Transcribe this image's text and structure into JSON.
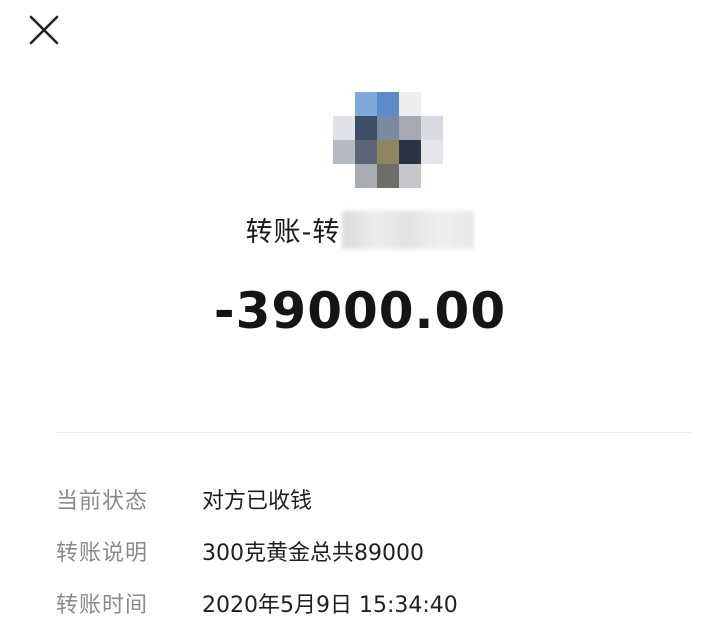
{
  "header": {
    "close_icon": "close-icon"
  },
  "payee": {
    "avatar_colors": [
      "#ffffff",
      "#7fa9d9",
      "#5c8bc9",
      "#eeeeee",
      "#ffffff",
      "#dfe2e8",
      "#3d4e66",
      "#7a8aa0",
      "#a5aab4",
      "#d7dbe1",
      "#b6bac2",
      "#5a6677",
      "#8e8560",
      "#2a3444",
      "#e3e5e9",
      "#ffffff",
      "#a8adb4",
      "#6d6e68",
      "#c4c7cc",
      "#ffffff"
    ],
    "title_prefix": "转账-转"
  },
  "amount": "-39000.00",
  "details": [
    {
      "label": "当前状态",
      "value": "对方已收钱"
    },
    {
      "label": "转账说明",
      "value": "300克黄金总共89000"
    },
    {
      "label": "转账时间",
      "value": "2020年5月9日 15:34:40"
    }
  ]
}
